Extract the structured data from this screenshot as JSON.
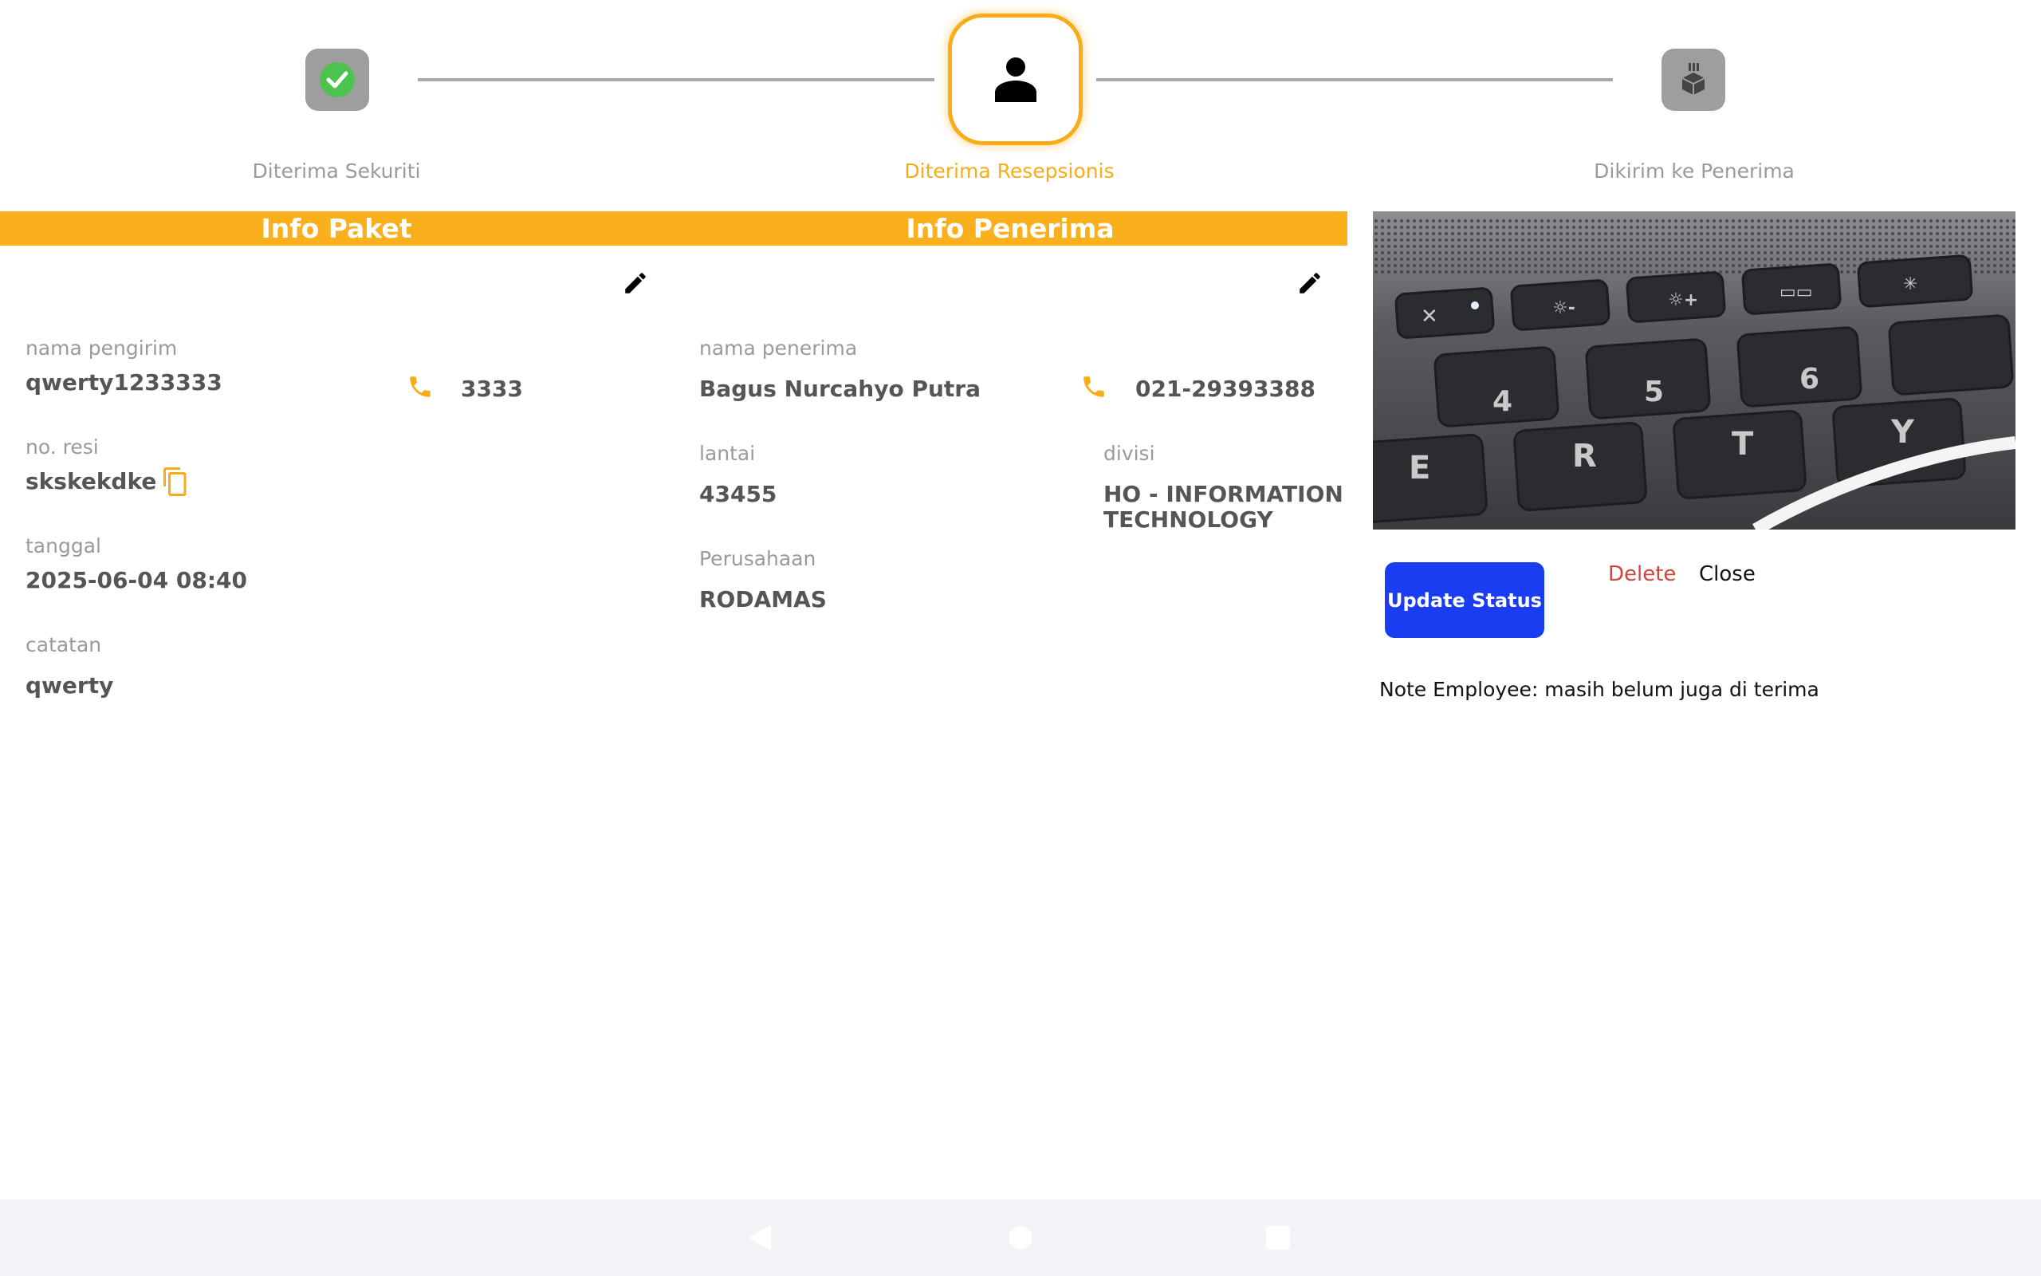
{
  "stepper": {
    "steps": [
      {
        "label": "Diterima Sekuriti",
        "status": "done",
        "icon": "check-circle-icon"
      },
      {
        "label": "Diterima Resepsionis",
        "status": "active",
        "icon": "person-icon"
      },
      {
        "label": "Dikirim ke Penerima",
        "status": "pending",
        "icon": "parcel-hand-icon"
      }
    ]
  },
  "colors": {
    "accent": "#f9ac17",
    "header_bar": "#f9b01c",
    "update_button": "#1a3df2",
    "delete_text": "#d0453f",
    "done_check": "#4cc24f"
  },
  "info_paket": {
    "title": "Info Paket",
    "nama_pengirim_label": "nama pengirim",
    "nama_pengirim_value": "qwerty1233333",
    "phone": "3333",
    "no_resi_label": "no. resi",
    "no_resi_value": "skskekdke",
    "tanggal_label": "tanggal",
    "tanggal_value": "2025-06-04 08:40",
    "catatan_label": "catatan",
    "catatan_value": "qwerty"
  },
  "info_penerima": {
    "title": "Info Penerima",
    "nama_penerima_label": "nama penerima",
    "nama_penerima_value": "Bagus Nurcahyo Putra",
    "phone": "021-29393388",
    "lantai_label": "lantai",
    "lantai_value": "43455",
    "divisi_label": "divisi",
    "divisi_value_line1": "HO - INFORMATION",
    "divisi_value_line2": "TECHNOLOGY",
    "perusahaan_label": "Perusahaan",
    "perusahaan_value": "RODAMAS"
  },
  "actions": {
    "update_label": "Update Status",
    "delete_label": "Delete",
    "close_label": "Close"
  },
  "note": "Note Employee: masih belum juga di terima"
}
